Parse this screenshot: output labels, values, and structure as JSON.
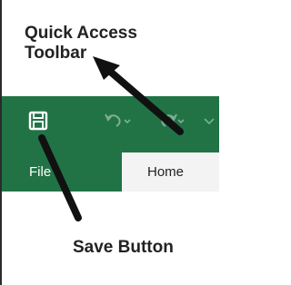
{
  "callouts": {
    "qat_line1": "Quick Access",
    "qat_line2": "Toolbar",
    "save_button": "Save Button"
  },
  "quick_access_toolbar": {
    "items": [
      {
        "icon": "save-icon"
      },
      {
        "icon": "undo-icon"
      },
      {
        "icon": "redo-icon"
      },
      {
        "icon": "customize-dropdown-icon"
      }
    ]
  },
  "ribbon_tabs": {
    "file": "File",
    "home": "Home"
  },
  "colors": {
    "ribbon_green": "#217346",
    "active_tab_bg": "#f3f3f3",
    "arrow": "#111111"
  }
}
